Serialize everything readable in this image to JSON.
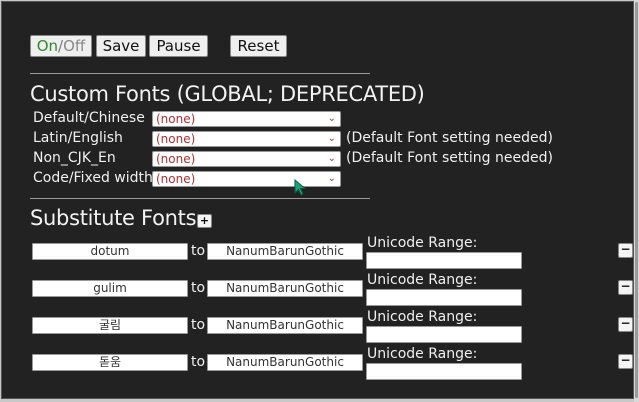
{
  "toolbar": {
    "on_label": "On",
    "slash": "/",
    "off_label": "Off",
    "save_label": "Save",
    "pause_label": "Pause",
    "reset_label": "Reset"
  },
  "custom_fonts": {
    "heading": "Custom Fonts (GLOBAL; DEPRECATED)",
    "rows": [
      {
        "label": "Default/Chinese",
        "value": "(none)",
        "note": ""
      },
      {
        "label": "Latin/English",
        "value": "(none)",
        "note": "(Default Font setting needed)"
      },
      {
        "label": "Non_CJK_En",
        "value": "(none)",
        "note": "(Default Font setting needed)"
      },
      {
        "label": "Code/Fixed width",
        "value": "(none)",
        "note": ""
      }
    ]
  },
  "substitute_fonts": {
    "heading": "Substitute Fonts",
    "add_label": "+",
    "to_label": "to",
    "range_label": "Unicode Range:",
    "remove_label": "−",
    "rows": [
      {
        "from": "dotum",
        "to": "NanumBarunGothic",
        "range": ""
      },
      {
        "from": "gulim",
        "to": "NanumBarunGothic",
        "range": ""
      },
      {
        "from": "굴림",
        "to": "NanumBarunGothic",
        "range": ""
      },
      {
        "from": "돋움",
        "to": "NanumBarunGothic",
        "range": ""
      }
    ]
  },
  "colors": {
    "panel_bg": "#222222",
    "on_green": "#2e8b2e",
    "select_text": "#b03030",
    "cursor": "#1aa37a"
  }
}
